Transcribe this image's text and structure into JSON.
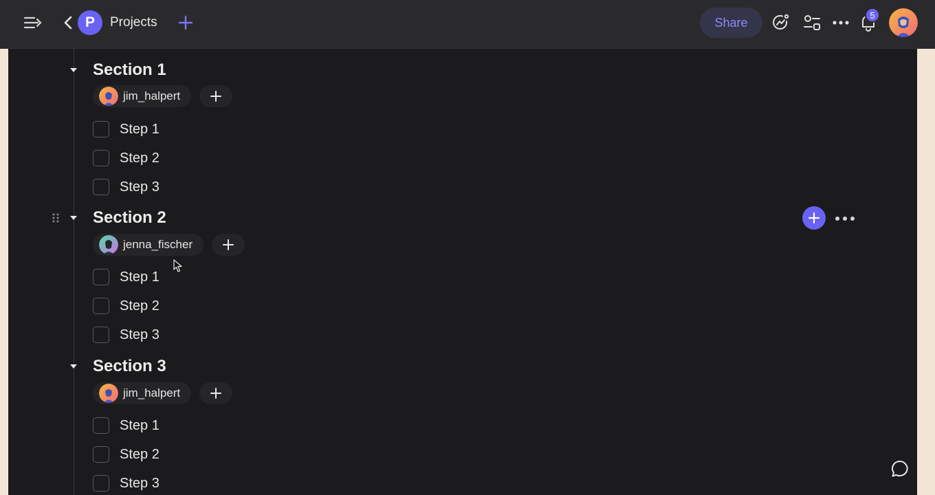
{
  "topbar": {
    "project_initial": "P",
    "project_title": "Projects",
    "share_label": "Share",
    "notification_count": "5"
  },
  "sections": [
    {
      "title": "Section 1",
      "assignee": "jim_halpert",
      "steps": [
        {
          "label": "Step 1",
          "checked": false
        },
        {
          "label": "Step 2",
          "checked": false
        },
        {
          "label": "Step 3",
          "checked": false
        }
      ]
    },
    {
      "title": "Section 2",
      "assignee": "jenna_fischer",
      "steps": [
        {
          "label": "Step 1",
          "checked": false
        },
        {
          "label": "Step 2",
          "checked": false
        },
        {
          "label": "Step 3",
          "checked": false
        }
      ]
    },
    {
      "title": "Section 3",
      "assignee": "jim_halpert",
      "steps": [
        {
          "label": "Step 1",
          "checked": false
        },
        {
          "label": "Step 2",
          "checked": false
        },
        {
          "label": "Step 3",
          "checked": false
        }
      ]
    }
  ],
  "icons": {
    "menu": "menu-collapse-icon",
    "back": "chevron-left-icon",
    "add": "plus-icon",
    "ai": "sparkle-chart-icon",
    "settings": "toggle-settings-icon",
    "more": "more-horizontal-icon",
    "notifications": "bell-icon",
    "chat": "chat-bubble-icon",
    "drag": "drag-handle-icon"
  },
  "colors": {
    "accent": "#6a62f5",
    "background": "#1b1b1d",
    "topbar": "#2a2a2c"
  }
}
